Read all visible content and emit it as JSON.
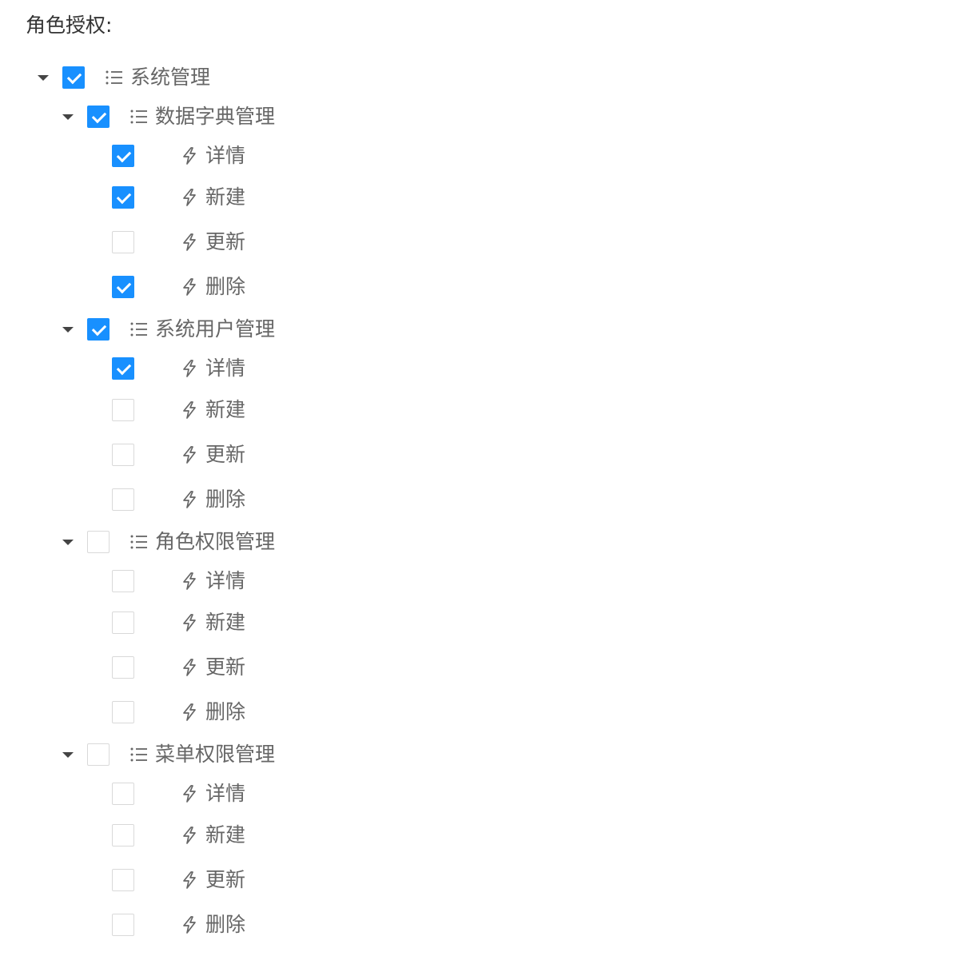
{
  "page": {
    "label": "角色授权:"
  },
  "tree": {
    "root": {
      "title": "系统管理",
      "checked": true,
      "expanded": true,
      "icon": "list-icon",
      "children": [
        {
          "title": "数据字典管理",
          "checked": true,
          "expanded": true,
          "icon": "list-icon",
          "children": [
            {
              "title": "详情",
              "checked": true,
              "icon": "lightning-icon"
            },
            {
              "title": "新建",
              "checked": true,
              "icon": "lightning-icon"
            },
            {
              "title": "更新",
              "checked": false,
              "icon": "lightning-icon"
            },
            {
              "title": "删除",
              "checked": true,
              "icon": "lightning-icon"
            }
          ]
        },
        {
          "title": "系统用户管理",
          "checked": true,
          "expanded": true,
          "icon": "list-icon",
          "children": [
            {
              "title": "详情",
              "checked": true,
              "icon": "lightning-icon"
            },
            {
              "title": "新建",
              "checked": false,
              "icon": "lightning-icon"
            },
            {
              "title": "更新",
              "checked": false,
              "icon": "lightning-icon"
            },
            {
              "title": "删除",
              "checked": false,
              "icon": "lightning-icon"
            }
          ]
        },
        {
          "title": "角色权限管理",
          "checked": false,
          "expanded": true,
          "icon": "list-icon",
          "children": [
            {
              "title": "详情",
              "checked": false,
              "icon": "lightning-icon"
            },
            {
              "title": "新建",
              "checked": false,
              "icon": "lightning-icon"
            },
            {
              "title": "更新",
              "checked": false,
              "icon": "lightning-icon"
            },
            {
              "title": "删除",
              "checked": false,
              "icon": "lightning-icon"
            }
          ]
        },
        {
          "title": "菜单权限管理",
          "checked": false,
          "expanded": true,
          "icon": "list-icon",
          "children": [
            {
              "title": "详情",
              "checked": false,
              "icon": "lightning-icon"
            },
            {
              "title": "新建",
              "checked": false,
              "icon": "lightning-icon"
            },
            {
              "title": "更新",
              "checked": false,
              "icon": "lightning-icon"
            },
            {
              "title": "删除",
              "checked": false,
              "icon": "lightning-icon"
            }
          ]
        }
      ]
    }
  },
  "colors": {
    "accent": "#1890ff",
    "text": "#666666",
    "label": "#333333",
    "checkbox_border": "#d9d9d9"
  }
}
